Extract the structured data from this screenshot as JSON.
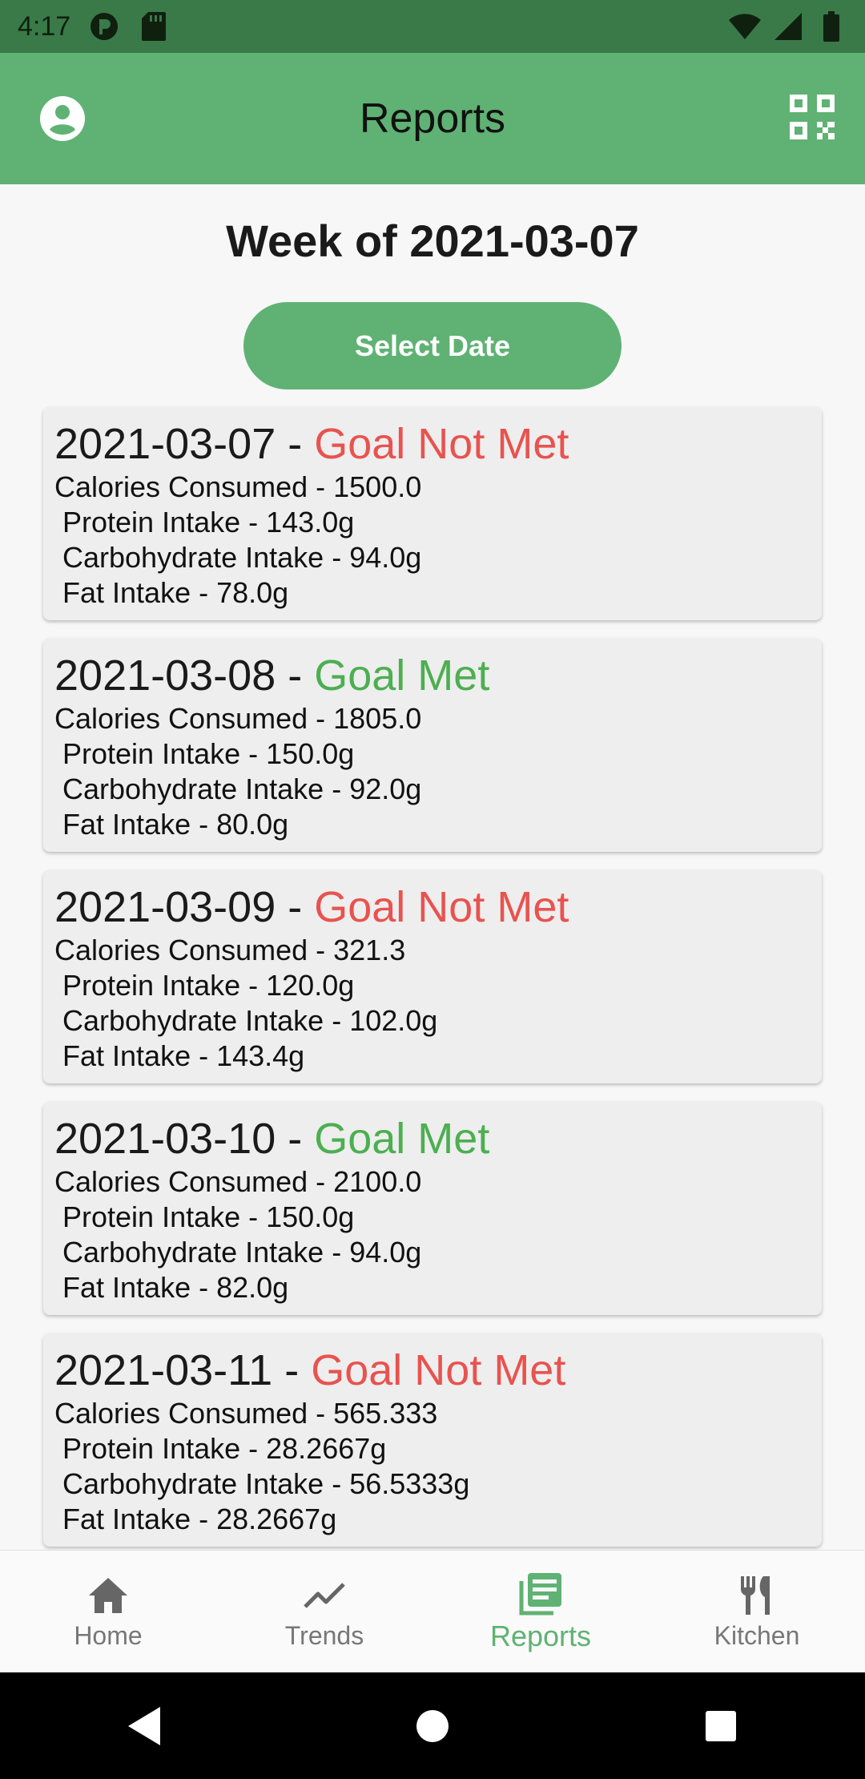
{
  "status_bar": {
    "time": "4:17",
    "icons": [
      "app-notification-icon",
      "sd-card-icon",
      "wifi-icon",
      "signal-icon",
      "battery-icon"
    ]
  },
  "app_bar": {
    "title": "Reports",
    "left_icon": "account-circle-icon",
    "right_icon": "qr-code-icon"
  },
  "week_title": "Week of 2021-03-07",
  "select_date_label": "Select Date",
  "reports": [
    {
      "date": "2021-03-07",
      "separator": " - ",
      "status": "Goal Not Met",
      "met": false,
      "calories": "Calories Consumed - 1500.0",
      "protein": "Protein Intake - 143.0g",
      "carbs": "Carbohydrate Intake - 94.0g",
      "fat": "Fat Intake - 78.0g"
    },
    {
      "date": "2021-03-08",
      "separator": " - ",
      "status": "Goal Met",
      "met": true,
      "calories": "Calories Consumed - 1805.0",
      "protein": "Protein Intake - 150.0g",
      "carbs": "Carbohydrate Intake - 92.0g",
      "fat": "Fat Intake - 80.0g"
    },
    {
      "date": "2021-03-09",
      "separator": " - ",
      "status": "Goal Not Met",
      "met": false,
      "calories": "Calories Consumed - 321.3",
      "protein": "Protein Intake - 120.0g",
      "carbs": "Carbohydrate Intake - 102.0g",
      "fat": "Fat Intake - 143.4g"
    },
    {
      "date": "2021-03-10",
      "separator": " - ",
      "status": "Goal Met",
      "met": true,
      "calories": "Calories Consumed - 2100.0",
      "protein": "Protein Intake - 150.0g",
      "carbs": "Carbohydrate Intake - 94.0g",
      "fat": "Fat Intake - 82.0g"
    },
    {
      "date": "2021-03-11",
      "separator": " - ",
      "status": "Goal Not Met",
      "met": false,
      "calories": "Calories Consumed - 565.333",
      "protein": "Protein Intake - 28.2667g",
      "carbs": "Carbohydrate Intake - 56.5333g",
      "fat": "Fat Intake - 28.2667g"
    }
  ],
  "bottom_nav": [
    {
      "label": "Home",
      "icon": "home-icon",
      "active": false
    },
    {
      "label": "Trends",
      "icon": "trending-up-icon",
      "active": false
    },
    {
      "label": "Reports",
      "icon": "reports-icon",
      "active": true
    },
    {
      "label": "Kitchen",
      "icon": "kitchen-icon",
      "active": false
    }
  ],
  "colors": {
    "primary": "#5fb273",
    "status_bar": "#3a7a48",
    "goal_met": "#4caf50",
    "goal_not_met": "#e8534f"
  }
}
